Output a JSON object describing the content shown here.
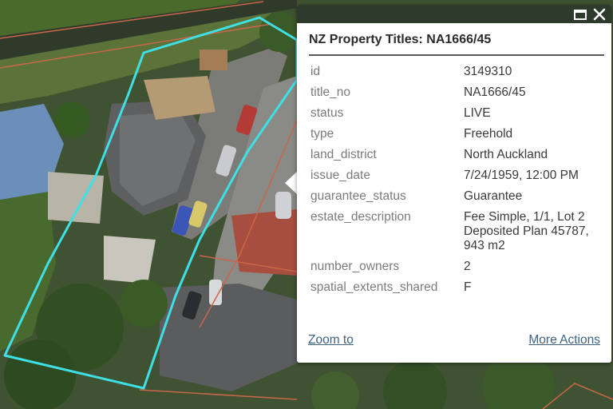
{
  "popup": {
    "title": "NZ Property Titles: NA1666/45",
    "fields": [
      {
        "key": "id",
        "value": "3149310"
      },
      {
        "key": "title_no",
        "value": "NA1666/45"
      },
      {
        "key": "status",
        "value": "LIVE"
      },
      {
        "key": "type",
        "value": "Freehold"
      },
      {
        "key": "land_district",
        "value": "North Auckland"
      },
      {
        "key": "issue_date",
        "value": "7/24/1959, 12:00 PM"
      },
      {
        "key": "guarantee_status",
        "value": "Guarantee"
      },
      {
        "key": "estate_description",
        "value": "Fee Simple, 1/1, Lot 2 Deposited Plan 45787, 943 m2"
      },
      {
        "key": "number_owners",
        "value": "2"
      },
      {
        "key": "spatial_extents_shared",
        "value": "F"
      }
    ],
    "actions": {
      "zoom_to": "Zoom to",
      "more_actions": "More Actions"
    },
    "header_icons": [
      "maximize-icon",
      "close-icon"
    ]
  },
  "colors": {
    "parcel_outline": "#3ee0e6",
    "boundary_lines": "#c8674a",
    "popup_header": "#2e3a2b",
    "link": "#3f6183"
  }
}
